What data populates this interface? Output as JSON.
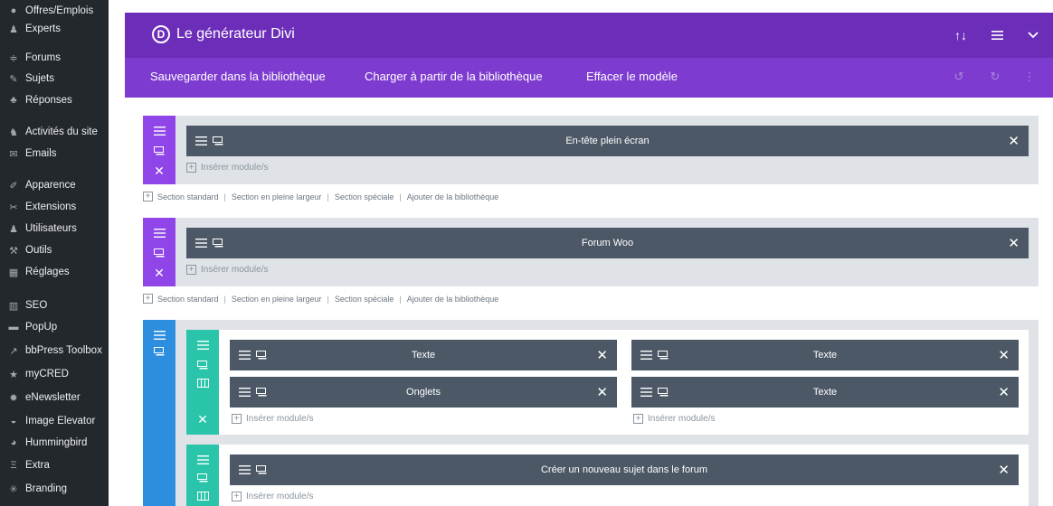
{
  "sidebar": {
    "items": [
      {
        "label": "Offres/Emplois",
        "icon": "globe-icon"
      },
      {
        "label": "Experts",
        "icon": "user-icon"
      },
      {
        "label": "Forums",
        "icon": "forums-icon"
      },
      {
        "label": "Sujets",
        "icon": "topics-icon"
      },
      {
        "label": "Réponses",
        "icon": "replies-icon"
      },
      {
        "label": "Activités du site",
        "icon": "activity-icon"
      },
      {
        "label": "Emails",
        "icon": "mail-icon"
      },
      {
        "label": "Apparence",
        "icon": "brush-icon"
      },
      {
        "label": "Extensions",
        "icon": "plugin-icon"
      },
      {
        "label": "Utilisateurs",
        "icon": "users-icon"
      },
      {
        "label": "Outils",
        "icon": "wrench-icon"
      },
      {
        "label": "Réglages",
        "icon": "settings-icon"
      },
      {
        "label": "SEO",
        "icon": "seo-icon"
      },
      {
        "label": "PopUp",
        "icon": "popup-icon"
      },
      {
        "label": "bbPress Toolbox",
        "icon": "toolbox-icon"
      },
      {
        "label": "myCRED",
        "icon": "star-icon"
      },
      {
        "label": "eNewsletter",
        "icon": "gear-icon"
      },
      {
        "label": "Image Elevator",
        "icon": "elevator-icon"
      },
      {
        "label": "Hummingbird",
        "icon": "hummingbird-icon"
      },
      {
        "label": "Extra",
        "icon": "extra-icon"
      },
      {
        "label": "Branding",
        "icon": "branding-icon"
      }
    ]
  },
  "builder": {
    "logo_letter": "D",
    "title": "Le générateur Divi",
    "header_icons": [
      "sort-arrows-icon",
      "menu-icon",
      "chevron-down-icon"
    ],
    "actions": {
      "save_library": "Sauvegarder dans la bibliothèque",
      "load_library": "Charger à partir de la bibliothèque",
      "clear_layout": "Effacer le modèle"
    },
    "bar_icons": [
      "undo-icon",
      "redo-icon",
      "history-icon"
    ]
  },
  "labels": {
    "insert_module": "Insérer module/s",
    "add_standard": "Section standard",
    "add_fullwidth": "Section en pleine largeur",
    "add_special": "Section spéciale",
    "add_library": "Ajouter de la bibliothèque",
    "separator": "|"
  },
  "sections": [
    {
      "type": "fullwidth",
      "row_title": "En-tête plein écran"
    },
    {
      "type": "fullwidth",
      "row_title": "Forum Woo"
    },
    {
      "type": "specialty",
      "rows": [
        {
          "modules_left": [
            "Texte",
            "Onglets"
          ],
          "modules_right": [
            "Texte",
            "Texte"
          ]
        },
        {
          "modules": [
            "Créer un nouveau sujet dans le forum"
          ]
        }
      ]
    }
  ],
  "colors": {
    "header_purple": "#6c2eb9",
    "bar_purple": "#7e3bd0",
    "fullwidth_section": "#8f45e8",
    "specialty_section": "#2d8ee0",
    "row_teal": "#29c4a9",
    "module_gray": "#4c5866",
    "section_bg": "#dfe3e7",
    "sidebar_bg": "#23282d"
  }
}
